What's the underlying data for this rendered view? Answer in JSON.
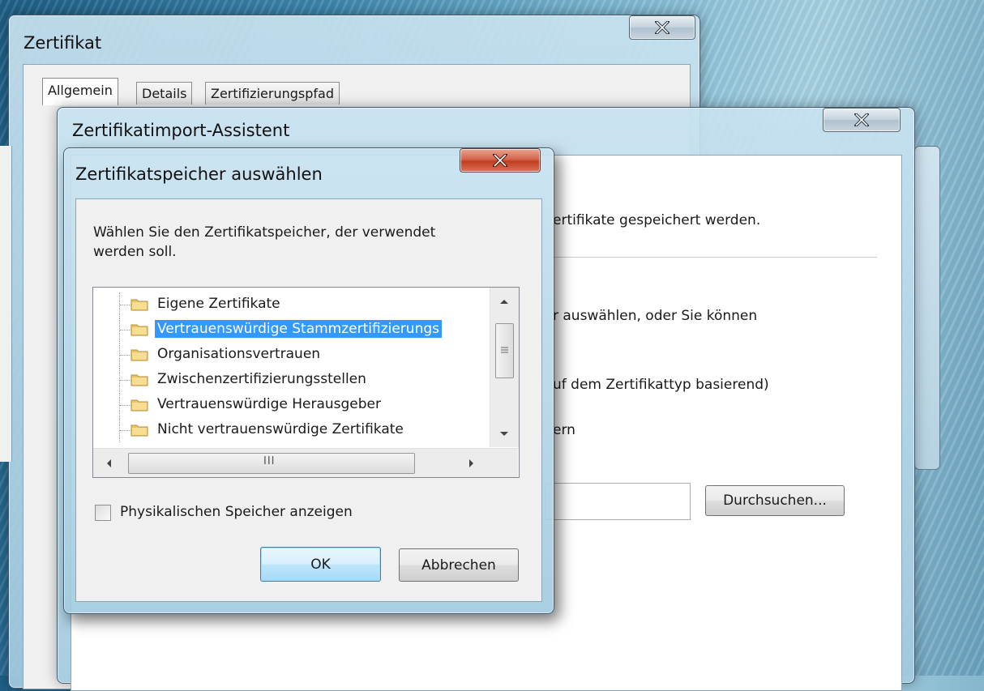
{
  "cert_window": {
    "title": "Zertifikat",
    "tabs": [
      "Allgemein",
      "Details",
      "Zertifizierungspfad"
    ]
  },
  "wizard": {
    "title": "Zertifikatimport-Assistent",
    "text_fragment_1": "ertifikate gespeichert werden.",
    "text_fragment_2": "r auswählen, oder Sie können",
    "text_fragment_3": "uf dem Zertifikattyp basierend)",
    "text_fragment_4": "ern",
    "browse_label": "Durchsuchen..."
  },
  "store_dialog": {
    "title": "Zertifikatspeicher auswählen",
    "instruction_line1": "Wählen Sie den Zertifikatspeicher, der verwendet",
    "instruction_line2": "werden soll.",
    "tree_items": [
      "Eigene Zertifikate",
      "Vertrauenswürdige Stammzertifizierungs",
      "Organisationsvertrauen",
      "Zwischenzertifizierungsstellen",
      "Vertrauenswürdige Herausgeber",
      "Nicht vertrauenswürdige Zertifikate"
    ],
    "selected_index": 1,
    "hscroll_thumb_glyph": "III",
    "checkbox_label": "Physikalischen Speicher anzeigen",
    "checkbox_checked": false,
    "ok_label": "OK",
    "cancel_label": "Abbrechen"
  },
  "colors": {
    "selection": "#3399ff",
    "close_red": "#c23d1f",
    "default_button": "#bee6fd"
  }
}
